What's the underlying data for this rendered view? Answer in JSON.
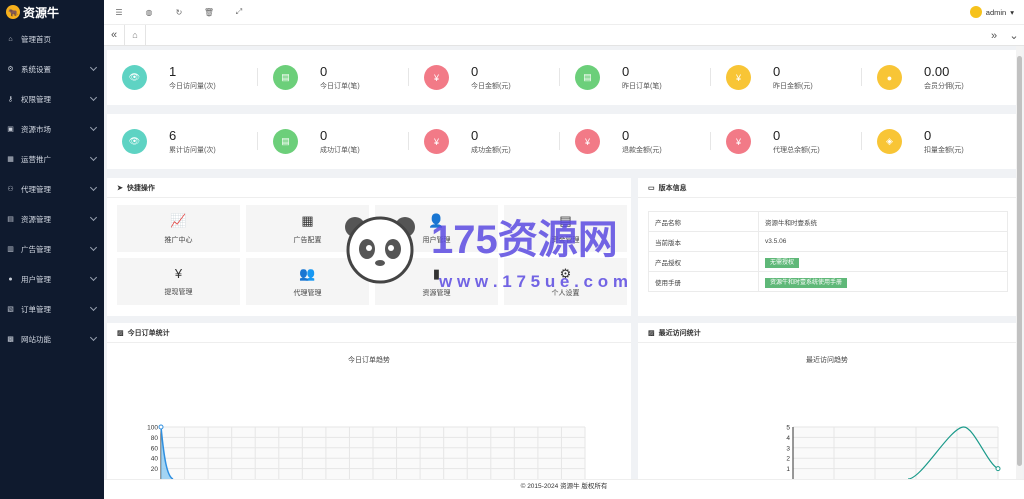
{
  "brand": "资源牛",
  "user": {
    "name": "admin"
  },
  "sidebar": [
    {
      "label": "管理首页",
      "icon": "⌂"
    },
    {
      "label": "系统设置",
      "icon": "⚙"
    },
    {
      "label": "权限管理",
      "icon": "⚷"
    },
    {
      "label": "资源市场",
      "icon": "▣"
    },
    {
      "label": "运营推广",
      "icon": "▦"
    },
    {
      "label": "代理管理",
      "icon": "⚇"
    },
    {
      "label": "资源管理",
      "icon": "▤"
    },
    {
      "label": "广告管理",
      "icon": "▥"
    },
    {
      "label": "用户管理",
      "icon": "●"
    },
    {
      "label": "订单管理",
      "icon": "▧"
    },
    {
      "label": "网站功能",
      "icon": "▩"
    }
  ],
  "stats_row1": [
    {
      "value": "1",
      "label": "今日访问量(次)",
      "color": "#5ed3c3",
      "icon": "👁"
    },
    {
      "value": "0",
      "label": "今日订单(笔)",
      "color": "#6ccf7a",
      "icon": "▤"
    },
    {
      "value": "0",
      "label": "今日金额(元)",
      "color": "#f27a87",
      "icon": "¥"
    },
    {
      "value": "0",
      "label": "昨日订单(笔)",
      "color": "#6ccf7a",
      "icon": "▤"
    },
    {
      "value": "0",
      "label": "昨日金额(元)",
      "color": "#f8c536",
      "icon": "¥"
    },
    {
      "value": "0.00",
      "label": "会员分佣(元)",
      "color": "#f8c536",
      "icon": "●"
    }
  ],
  "stats_row2": [
    {
      "value": "6",
      "label": "累计访问量(次)",
      "color": "#5ed3c3",
      "icon": "👁"
    },
    {
      "value": "0",
      "label": "成功订单(笔)",
      "color": "#6ccf7a",
      "icon": "▤"
    },
    {
      "value": "0",
      "label": "成功金额(元)",
      "color": "#f27a87",
      "icon": "¥"
    },
    {
      "value": "0",
      "label": "退款金额(元)",
      "color": "#f27a87",
      "icon": "¥"
    },
    {
      "value": "0",
      "label": "代理总余额(元)",
      "color": "#f27a87",
      "icon": "¥"
    },
    {
      "value": "0",
      "label": "扣量金额(元)",
      "color": "#f8c536",
      "icon": "◈"
    }
  ],
  "quick": {
    "title": "快捷操作",
    "items": [
      {
        "label": "推广中心",
        "icon": "📈"
      },
      {
        "label": "广告配置",
        "icon": "▦"
      },
      {
        "label": "用户管理",
        "icon": "👤"
      },
      {
        "label": "资金管理",
        "icon": "▤"
      },
      {
        "label": "提现管理",
        "icon": "¥"
      },
      {
        "label": "代理管理",
        "icon": "👥"
      },
      {
        "label": "资源管理",
        "icon": "▮"
      },
      {
        "label": "个人设置",
        "icon": "⚙"
      }
    ]
  },
  "version": {
    "title": "版本信息",
    "rows": [
      {
        "k": "产品名称",
        "v": "资源牛和时壹系统"
      },
      {
        "k": "当前版本",
        "v": "v3.5.06"
      },
      {
        "k": "产品授权",
        "v": "无需授权",
        "badge": true
      },
      {
        "k": "使用手册",
        "v": "资源牛和时壹系统使用手册",
        "badge": true
      }
    ]
  },
  "order_panel": {
    "title": "今日订单统计",
    "chart_title": "今日订单趋势"
  },
  "visit_panel": {
    "title": "最近访问统计",
    "chart_title": "最近访问趋势"
  },
  "watermark": {
    "text": "175资源网",
    "url": "w w w . 1 7 5 u e . c o m"
  },
  "footer": "© 2015-2024 资源牛 版权所有",
  "chart_data": [
    {
      "type": "area",
      "title": "今日订单趋势",
      "y_ticks": [
        100,
        80,
        60,
        40,
        20
      ],
      "ylim": [
        0,
        100
      ],
      "series": [
        {
          "values": [
            100,
            0,
            0,
            0,
            0,
            0,
            0,
            0,
            0,
            0,
            0,
            0,
            0,
            0,
            0,
            0,
            0,
            0,
            0,
            0
          ]
        }
      ]
    },
    {
      "type": "line",
      "title": "最近访问趋势",
      "y_ticks": [
        5,
        4,
        3,
        2,
        1
      ],
      "ylim": [
        0,
        5
      ],
      "series": [
        {
          "values": [
            0,
            0,
            0,
            0,
            0,
            5,
            1
          ]
        }
      ]
    }
  ]
}
